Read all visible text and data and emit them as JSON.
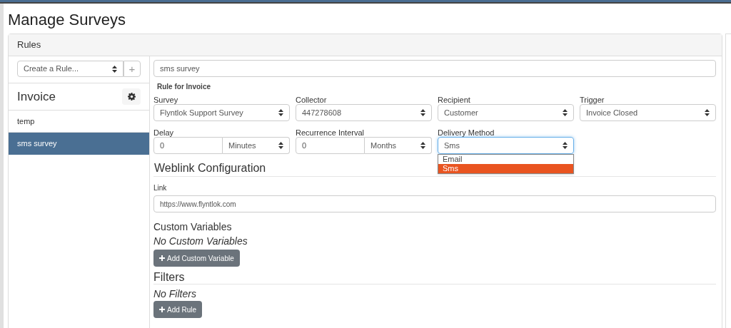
{
  "page_title": "Manage Surveys",
  "panel": {
    "title": "Rules"
  },
  "sidebar": {
    "create_select": {
      "value": "Create a Rule..."
    },
    "add_button": "+",
    "group_title": "Invoice",
    "items": [
      {
        "label": "temp",
        "selected": false
      },
      {
        "label": "sms survey",
        "selected": true
      }
    ]
  },
  "rule": {
    "name": "sms survey",
    "subtitle": "Rule for Invoice",
    "fields": [
      {
        "label": "Survey",
        "kind": "select",
        "value": "Flyntlok Support Survey"
      },
      {
        "label": "Collector",
        "kind": "select",
        "value": "447278608"
      },
      {
        "label": "Recipient",
        "kind": "select",
        "value": "Customer"
      },
      {
        "label": "Trigger",
        "kind": "select",
        "value": "Invoice Closed"
      },
      {
        "label": "Delay",
        "kind": "pair",
        "value": "0",
        "unit": "Minutes"
      },
      {
        "label": "Recurrence Interval",
        "kind": "pair",
        "value": "0",
        "unit": "Months"
      },
      {
        "label": "Delivery Method",
        "kind": "select",
        "value": "Sms",
        "expanded": true,
        "options": [
          {
            "label": "Email",
            "selected": false
          },
          {
            "label": "Sms",
            "selected": true
          }
        ]
      }
    ]
  },
  "weblink": {
    "title": "Weblink Configuration",
    "link_label": "Link",
    "link_value": "https://www.flyntlok.com"
  },
  "custom_variables": {
    "title": "Custom Variables",
    "empty": "No Custom Variables",
    "button": "Add Custom Variable"
  },
  "filters": {
    "title": "Filters",
    "empty": "No Filters",
    "button": "Add Rule"
  }
}
